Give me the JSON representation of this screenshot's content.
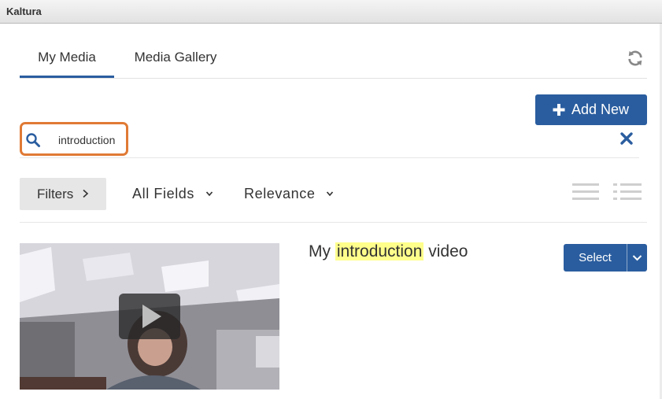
{
  "window": {
    "title": "Kaltura"
  },
  "tabs": [
    {
      "label": "My Media",
      "active": true
    },
    {
      "label": "Media Gallery",
      "active": false
    }
  ],
  "toolbar": {
    "add_new_label": "Add New",
    "refresh_icon": "refresh-icon"
  },
  "search": {
    "value": "introduction",
    "placeholder": ""
  },
  "filters": {
    "filters_label": "Filters",
    "fields_label": "All Fields",
    "sort_label": "Relevance"
  },
  "media": [
    {
      "title_before": "My",
      "title_highlight": "introduction",
      "title_after": "video",
      "action_label": "Select"
    }
  ],
  "colors": {
    "primary": "#2a5d9f",
    "highlight_outline": "#e07a35",
    "search_highlight": "#ffff8c"
  }
}
